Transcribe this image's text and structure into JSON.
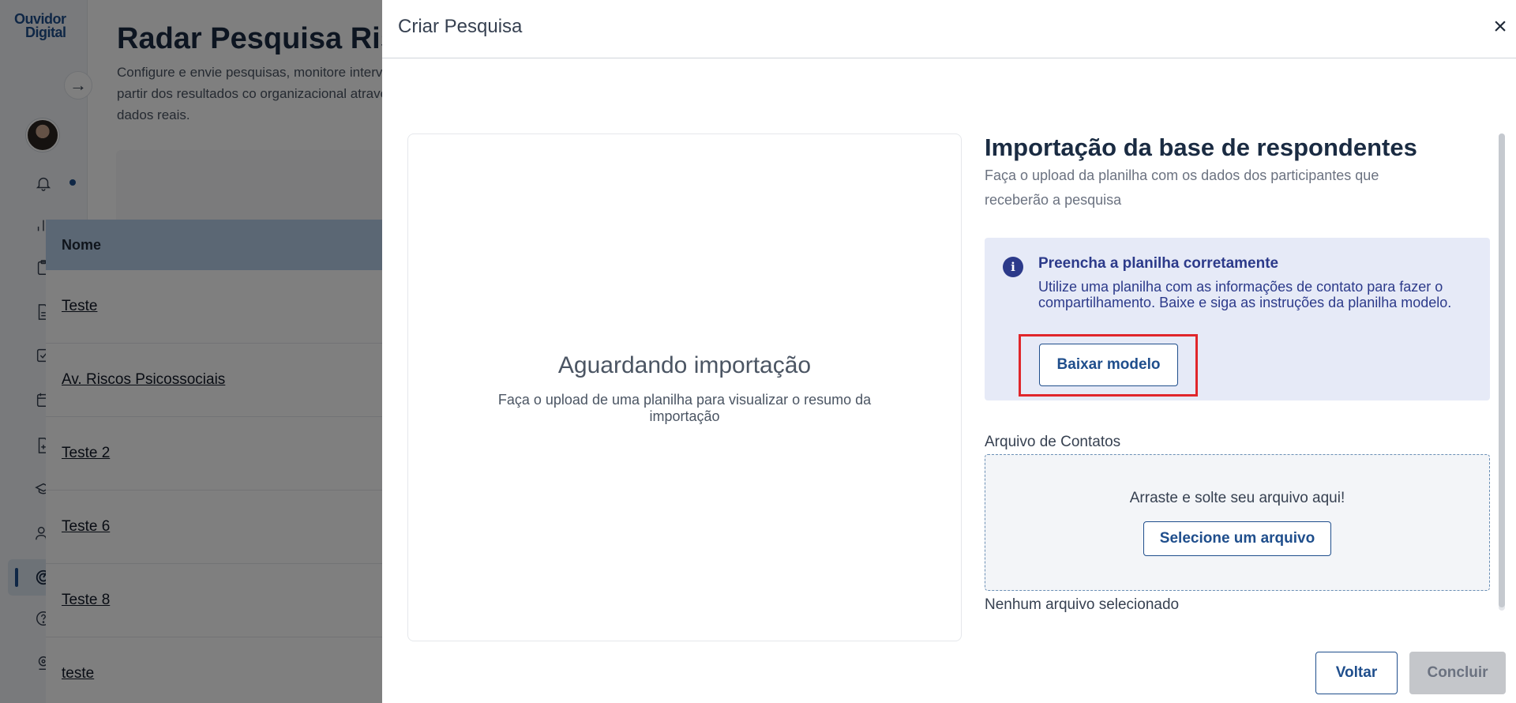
{
  "app": {
    "logo_line1": "Ouvidor",
    "logo_line2": "Digital",
    "page_title": "Radar Pesquisa Ris",
    "page_description": "Configure e envie pesquisas, monitore intervenção a partir dos resultados co organizacional através de dados reais.",
    "table": {
      "header": "Nome",
      "rows": [
        "Teste",
        "Av. Riscos Psicossociais",
        "Teste 2",
        "Teste 6",
        "Teste 8",
        "teste"
      ]
    },
    "sidebar_icons": [
      "bell-icon",
      "bar-chart-icon",
      "clipboard-icon",
      "document-icon",
      "checkbox-icon",
      "calendar-icon",
      "file-plus-icon",
      "graduation-cap-icon",
      "users-icon",
      "radar-icon",
      "help-icon",
      "location-icon"
    ]
  },
  "drawer": {
    "title": "Criar Pesquisa",
    "close_symbol": "×",
    "preview": {
      "title": "Aguardando importação",
      "subtitle": "Faça o upload de uma planilha para visualizar o resumo da importação"
    },
    "import": {
      "title": "Importação da base de respondentes",
      "description": "Faça o upload da planilha com os dados dos participantes que receberão a pesquisa"
    },
    "info": {
      "title": "Preencha a planilha corretamente",
      "text": "Utilize uma planilha com as informações de contato para fazer o compartilhamento. Baixe e siga as instruções da planilha modelo.",
      "button": "Baixar modelo"
    },
    "file": {
      "label": "Arquivo de Contatos",
      "drop_text": "Arraste e solte seu arquivo aqui!",
      "select_button": "Selecione um arquivo",
      "status": "Nenhum arquivo selecionado"
    },
    "footer": {
      "back": "Voltar",
      "finish": "Concluir"
    }
  },
  "colors": {
    "primary": "#1f4e8c",
    "info_bg": "#e6eaf7",
    "info_text": "#2c3a8a",
    "highlight": "#e0262b",
    "disabled": "#c4c6ca"
  }
}
